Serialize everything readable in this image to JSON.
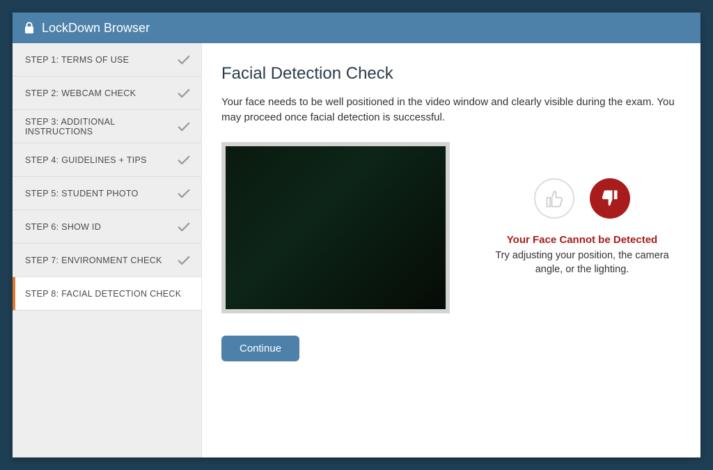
{
  "header": {
    "title": "LockDown Browser"
  },
  "sidebar": {
    "steps": [
      {
        "label": "STEP 1: TERMS OF USE",
        "completed": true,
        "active": false
      },
      {
        "label": "STEP 2: WEBCAM CHECK",
        "completed": true,
        "active": false
      },
      {
        "label": "STEP 3: ADDITIONAL INSTRUCTIONS",
        "completed": true,
        "active": false
      },
      {
        "label": "STEP 4: GUIDELINES + TIPS",
        "completed": true,
        "active": false
      },
      {
        "label": "STEP 5: STUDENT PHOTO",
        "completed": true,
        "active": false
      },
      {
        "label": "STEP 6: SHOW ID",
        "completed": true,
        "active": false
      },
      {
        "label": "STEP 7: ENVIRONMENT CHECK",
        "completed": true,
        "active": false
      },
      {
        "label": "STEP 8: FACIAL DETECTION CHECK",
        "completed": false,
        "active": true
      }
    ]
  },
  "main": {
    "title": "Facial Detection Check",
    "description": "Your face needs to be well positioned in the video window and clearly visible during the exam. You may proceed once facial detection is successful.",
    "status": {
      "detected": false,
      "title": "Your Face Cannot be Detected",
      "subtitle": "Try adjusting your position, the camera angle, or the lighting."
    },
    "continue_label": "Continue"
  },
  "colors": {
    "accent": "#4d81a9",
    "frame": "#1e3e54",
    "active_indicator": "#e07a2e",
    "error": "#a81c1c"
  }
}
